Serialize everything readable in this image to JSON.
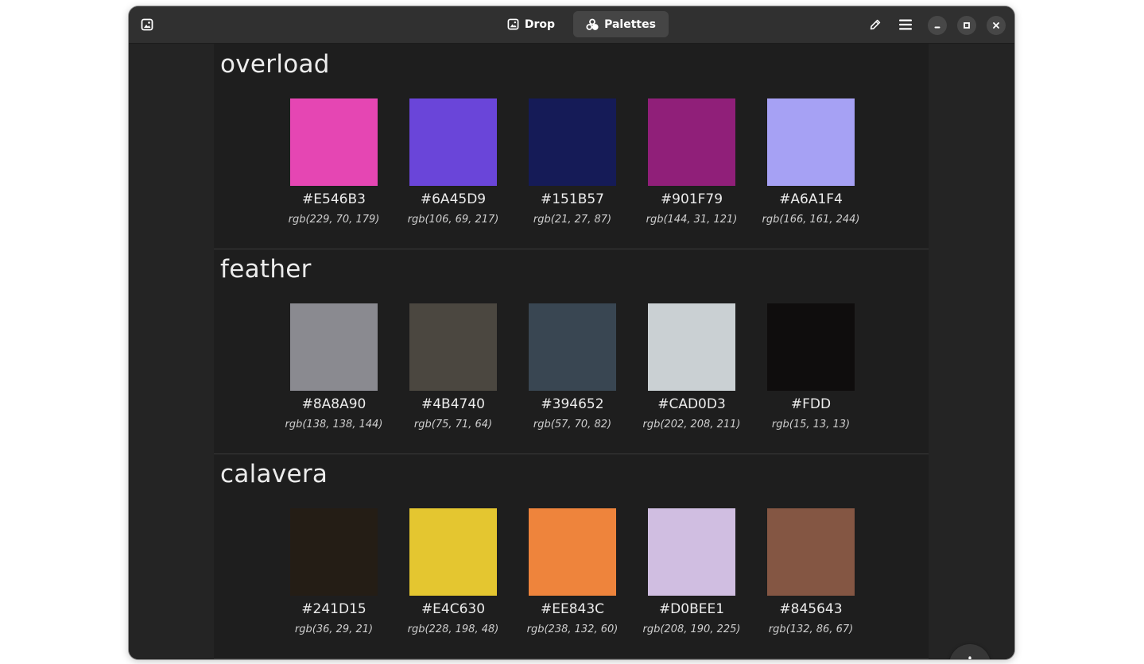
{
  "window": {
    "tabs": [
      {
        "label": "Drop",
        "icon": "image-icon",
        "active": false
      },
      {
        "label": "Palettes",
        "icon": "palette-icon",
        "active": true
      }
    ]
  },
  "palettes": [
    {
      "name": "overload",
      "colors": [
        {
          "hex": "#E546B3",
          "rgb": "rgb(229, 70, 179)",
          "swatch": "#E546B3"
        },
        {
          "hex": "#6A45D9",
          "rgb": "rgb(106, 69, 217)",
          "swatch": "#6A45D9"
        },
        {
          "hex": "#151B57",
          "rgb": "rgb(21, 27, 87)",
          "swatch": "#151B57"
        },
        {
          "hex": "#901F79",
          "rgb": "rgb(144, 31, 121)",
          "swatch": "#901F79"
        },
        {
          "hex": "#A6A1F4",
          "rgb": "rgb(166, 161, 244)",
          "swatch": "#A6A1F4"
        }
      ]
    },
    {
      "name": "feather",
      "colors": [
        {
          "hex": "#8A8A90",
          "rgb": "rgb(138, 138, 144)",
          "swatch": "#8A8A90"
        },
        {
          "hex": "#4B4740",
          "rgb": "rgb(75, 71, 64)",
          "swatch": "#4B4740"
        },
        {
          "hex": "#394652",
          "rgb": "rgb(57, 70, 82)",
          "swatch": "#394652"
        },
        {
          "hex": "#CAD0D3",
          "rgb": "rgb(202, 208, 211)",
          "swatch": "#CAD0D3"
        },
        {
          "hex": "#FDD",
          "rgb": "rgb(15, 13, 13)",
          "swatch": "#0F0D0D"
        }
      ]
    },
    {
      "name": "calavera",
      "colors": [
        {
          "hex": "#241D15",
          "rgb": "rgb(36, 29, 21)",
          "swatch": "#241D15"
        },
        {
          "hex": "#E4C630",
          "rgb": "rgb(228, 198, 48)",
          "swatch": "#E4C630"
        },
        {
          "hex": "#EE843C",
          "rgb": "rgb(238, 132, 60)",
          "swatch": "#EE843C"
        },
        {
          "hex": "#D0BEE1",
          "rgb": "rgb(208, 190, 225)",
          "swatch": "#D0BEE1"
        },
        {
          "hex": "#845643",
          "rgb": "rgb(132, 86, 67)",
          "swatch": "#845643"
        }
      ]
    }
  ],
  "icons": {
    "app": "image-icon",
    "pick": "pencil-icon",
    "menu": "hamburger-menu-icon",
    "minimize": "minimize-icon",
    "maximize": "maximize-icon",
    "close": "close-icon",
    "add": "plus-icon"
  }
}
